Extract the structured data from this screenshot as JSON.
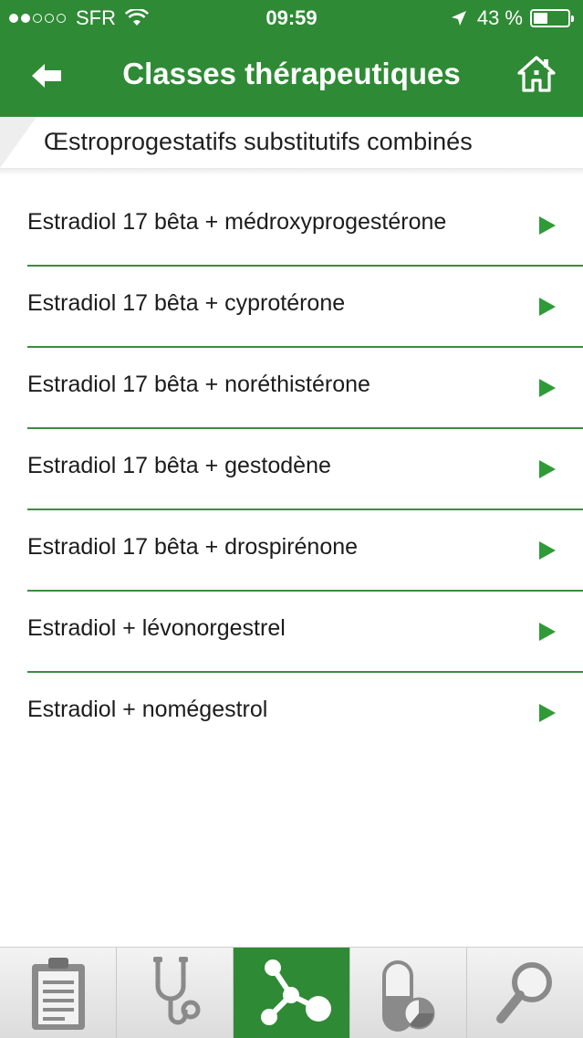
{
  "status_bar": {
    "carrier": "SFR",
    "time": "09:59",
    "battery_percent": "43 %",
    "battery_level": 0.43,
    "signal_bars_filled": 2,
    "signal_bars_total": 5
  },
  "nav": {
    "title": "Classes thérapeutiques",
    "back_icon": "back-arrow-icon",
    "home_icon": "home-icon"
  },
  "section": {
    "title": "Œstroprogestatifs substitutifs combinés"
  },
  "list": {
    "items": [
      {
        "label": "Estradiol 17 bêta + médroxyprogestérone"
      },
      {
        "label": "Estradiol 17 bêta + cyprotérone"
      },
      {
        "label": "Estradiol 17 bêta + noréthistérone"
      },
      {
        "label": "Estradiol 17 bêta + gestodène"
      },
      {
        "label": "Estradiol 17 bêta + drospirénone"
      },
      {
        "label": "Estradiol + lévonorgestrel"
      },
      {
        "label": "Estradiol + nomégestrol"
      }
    ]
  },
  "tabs": [
    {
      "icon": "clipboard-icon",
      "active": false
    },
    {
      "icon": "stethoscope-icon",
      "active": false
    },
    {
      "icon": "molecule-icon",
      "active": true
    },
    {
      "icon": "pill-chart-icon",
      "active": false
    },
    {
      "icon": "search-icon",
      "active": false
    }
  ],
  "colors": {
    "brand_green": "#2f8a35",
    "arrow_green": "#2f9b37",
    "divider_green": "#3a8e3f"
  }
}
